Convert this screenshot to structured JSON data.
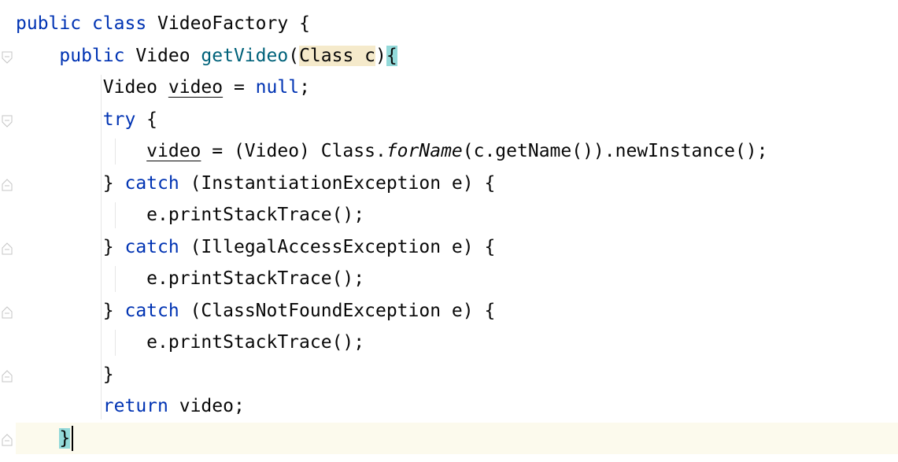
{
  "editor": {
    "lines": [
      [
        [
          "public",
          "kw"
        ],
        [
          " "
        ],
        [
          "class",
          "kw"
        ],
        [
          " VideoFactory {"
        ]
      ],
      [
        [
          "    "
        ],
        [
          "public",
          "kw"
        ],
        [
          " Video "
        ],
        [
          "getVideo",
          "m-decl"
        ],
        [
          "("
        ],
        [
          "Class c",
          "hl-param"
        ],
        [
          ")"
        ],
        [
          "{",
          "hl-brace"
        ]
      ],
      [
        [
          "        Video "
        ],
        [
          "video",
          "uvar"
        ],
        [
          " = "
        ],
        [
          "null",
          "kw"
        ],
        [
          ";"
        ]
      ],
      [
        [
          "        "
        ],
        [
          "try",
          "kw"
        ],
        [
          " {"
        ]
      ],
      [
        [
          "            "
        ],
        [
          "video",
          "uvar"
        ],
        [
          " = (Video) Class."
        ],
        [
          "forName",
          "m-static"
        ],
        [
          "(c.getName()).newInstance();"
        ]
      ],
      [
        [
          "        } "
        ],
        [
          "catch",
          "kw"
        ],
        [
          " (InstantiationException e) {"
        ]
      ],
      [
        [
          "            e.printStackTrace();"
        ]
      ],
      [
        [
          "        } "
        ],
        [
          "catch",
          "kw"
        ],
        [
          " (IllegalAccessException e) {"
        ]
      ],
      [
        [
          "            e.printStackTrace();"
        ]
      ],
      [
        [
          "        } "
        ],
        [
          "catch",
          "kw"
        ],
        [
          " (ClassNotFoundException e) {"
        ]
      ],
      [
        [
          "            e.printStackTrace();"
        ]
      ],
      [
        [
          "        }"
        ]
      ],
      [
        [
          "        "
        ],
        [
          "return",
          "kw"
        ],
        [
          " video;"
        ]
      ],
      [
        [
          "    "
        ],
        [
          "}",
          "hl-brace"
        ]
      ]
    ],
    "current_line": 13,
    "colors": {
      "keyword": "#0033b3",
      "method_declaration": "#00627a",
      "text": "#080808",
      "current_line_bg": "#fcfaed",
      "matched_brace_bg": "#93d9d9",
      "param_highlight_bg": "#f5eacb"
    },
    "fold_markers": [
      {
        "line": 1,
        "icon": "fold-open-icon"
      },
      {
        "line": 3,
        "icon": "fold-open-icon"
      },
      {
        "line": 5,
        "icon": "fold-close-icon"
      },
      {
        "line": 7,
        "icon": "fold-close-icon"
      },
      {
        "line": 9,
        "icon": "fold-close-icon"
      },
      {
        "line": 11,
        "icon": "fold-close-icon"
      },
      {
        "line": 13,
        "icon": "fold-close-icon"
      }
    ]
  }
}
